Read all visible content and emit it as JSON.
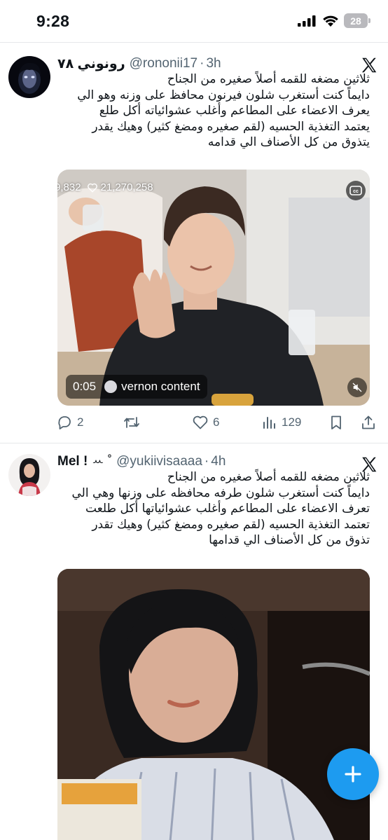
{
  "status_bar": {
    "time": "9:28",
    "battery": "28"
  },
  "tweets": [
    {
      "display_name": "رونوني ٧٨",
      "handle": "@rononii17",
      "time_ago": "3h",
      "text_lines": [
        "ثلاثين مضغه للقمه أصلاً صغيره من الجناح",
        "دايماً كنت أستغرب شلون فيرنون محافظ على وزنه وهو الي",
        "يعرف الاعضاء على المطاعم وأغلب عشوائياته أكل طلع",
        "يعتمد التغذية الحسيه (لقم صغيره ومضغ كثير) وهيك يقدر",
        "يتذوق من كل الأصناف الي قدامه"
      ],
      "video": {
        "stats_views": "9,832",
        "stats_likes": "21,270,258",
        "duration": "0:05",
        "source": "vernon content"
      },
      "actions": {
        "replies": "2",
        "reposts": "",
        "likes": "6",
        "views": "129"
      }
    },
    {
      "display_name": "Mel ! ",
      "handle": "@yukiivisaaaa",
      "time_ago": "4h",
      "text_lines": [
        "ثلاثين مضغه للقمه أصلاً صغيره من الجناح",
        "دايماً كنت أستغرب شلون طرفه محافظه على وزنها وهي الي",
        "تعرف الاعضاء على المطاعم وأغلب عشوائياتها أكل طلعت",
        "تعتمد التغذية الحسيه (لقم صغيره ومضغ كثير) وهيك تقدر",
        "تذوق من كل الأصناف الي قدامها"
      ]
    }
  ],
  "icons": {
    "signal": "cellular-signal-icon",
    "wifi": "wifi-icon",
    "x": "x-logo-icon",
    "reply": "reply-icon",
    "repost": "repost-icon",
    "like": "heart-icon",
    "views": "views-icon",
    "bookmark": "bookmark-icon",
    "share": "share-icon",
    "compose": "compose-plus-icon"
  },
  "colors": {
    "accent": "#1d9bf0",
    "secondary_text": "#536471",
    "primary_text": "#0f1419"
  }
}
